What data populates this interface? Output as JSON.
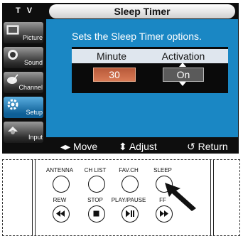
{
  "tv": {
    "label": "T V",
    "title": "Sleep Timer",
    "description": "Sets the Sleep Timer options.",
    "sidebar": [
      {
        "label": "Picture",
        "icon": "picture-icon",
        "active": false
      },
      {
        "label": "Sound",
        "icon": "sound-icon",
        "active": false
      },
      {
        "label": "Channel",
        "icon": "channel-icon",
        "active": false
      },
      {
        "label": "Setup",
        "icon": "setup-icon",
        "active": true
      },
      {
        "label": "Input",
        "icon": "input-icon",
        "active": false
      }
    ],
    "columns": {
      "minute": "Minute",
      "activation": "Activation"
    },
    "values": {
      "minute": "30",
      "activation": "On"
    },
    "footer": {
      "move": "◂▸ Move",
      "adjust": "⬍ Adjust",
      "return": "↺ Return"
    }
  },
  "remote": {
    "row1": [
      "ANTENNA",
      "CH LIST",
      "FAV.CH",
      "SLEEP"
    ],
    "row2": [
      "REW",
      "STOP",
      "PLAY/PAUSE",
      "FF"
    ]
  },
  "colors": {
    "accent": "#1a87c4",
    "selected_value": "#c8684a"
  }
}
